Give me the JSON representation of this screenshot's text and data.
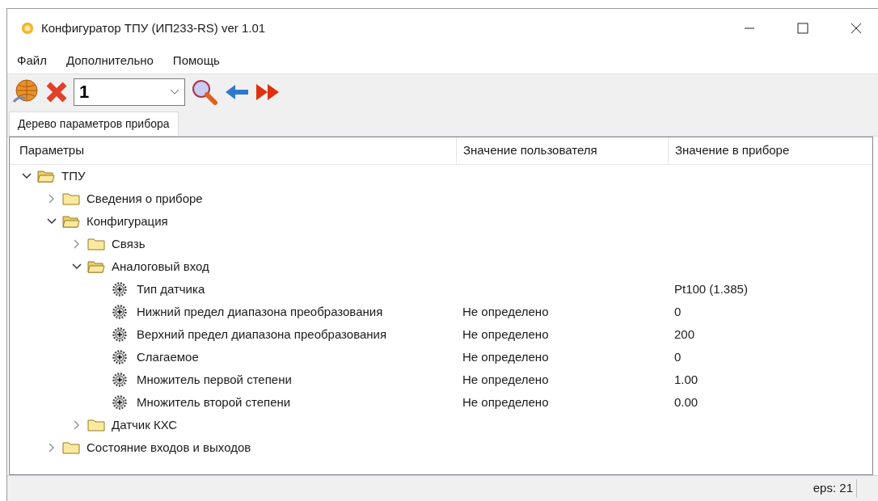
{
  "window": {
    "title": "Конфигуратор ТПУ (ИП233-RS) ver 1.01"
  },
  "menu": [
    "Файл",
    "Дополнительно",
    "Помощь"
  ],
  "toolbar": {
    "address": "1"
  },
  "tabs": [
    {
      "label": "Дерево параметров прибора",
      "selected": true
    }
  ],
  "table": {
    "columns": [
      "Параметры",
      "Значение пользователя",
      "Значение в приборе"
    ],
    "tree": [
      {
        "kind": "folder",
        "label": "ТПУ",
        "expanded": true,
        "children": [
          {
            "kind": "folder",
            "label": "Сведения о приборе",
            "expanded": false
          },
          {
            "kind": "folder",
            "label": "Конфигурация",
            "expanded": true,
            "children": [
              {
                "kind": "folder",
                "label": "Связь",
                "expanded": false
              },
              {
                "kind": "folder",
                "label": "Аналоговый вход",
                "expanded": true,
                "children": [
                  {
                    "kind": "param",
                    "label": "Тип датчика",
                    "device": "Pt100 (1.385)"
                  },
                  {
                    "kind": "param",
                    "label": "Нижний предел диапазона преобразования",
                    "user": "Не определено",
                    "device": "0"
                  },
                  {
                    "kind": "param",
                    "label": "Верхний предел диапазона преобразования",
                    "user": "Не определено",
                    "device": "200"
                  },
                  {
                    "kind": "param",
                    "label": "Слагаемое",
                    "user": "Не определено",
                    "device": "0"
                  },
                  {
                    "kind": "param",
                    "label": "Множитель первой степени",
                    "user": "Не определено",
                    "device": "1.00"
                  },
                  {
                    "kind": "param",
                    "label": "Множитель второй степени",
                    "user": "Не определено",
                    "device": "0.00"
                  }
                ]
              },
              {
                "kind": "folder",
                "label": "Датчик КХС",
                "expanded": false
              }
            ]
          },
          {
            "kind": "folder",
            "label": "Состояние входов и выходов",
            "expanded": false
          }
        ]
      }
    ]
  },
  "status_bar": {
    "text": "eps: 21"
  }
}
